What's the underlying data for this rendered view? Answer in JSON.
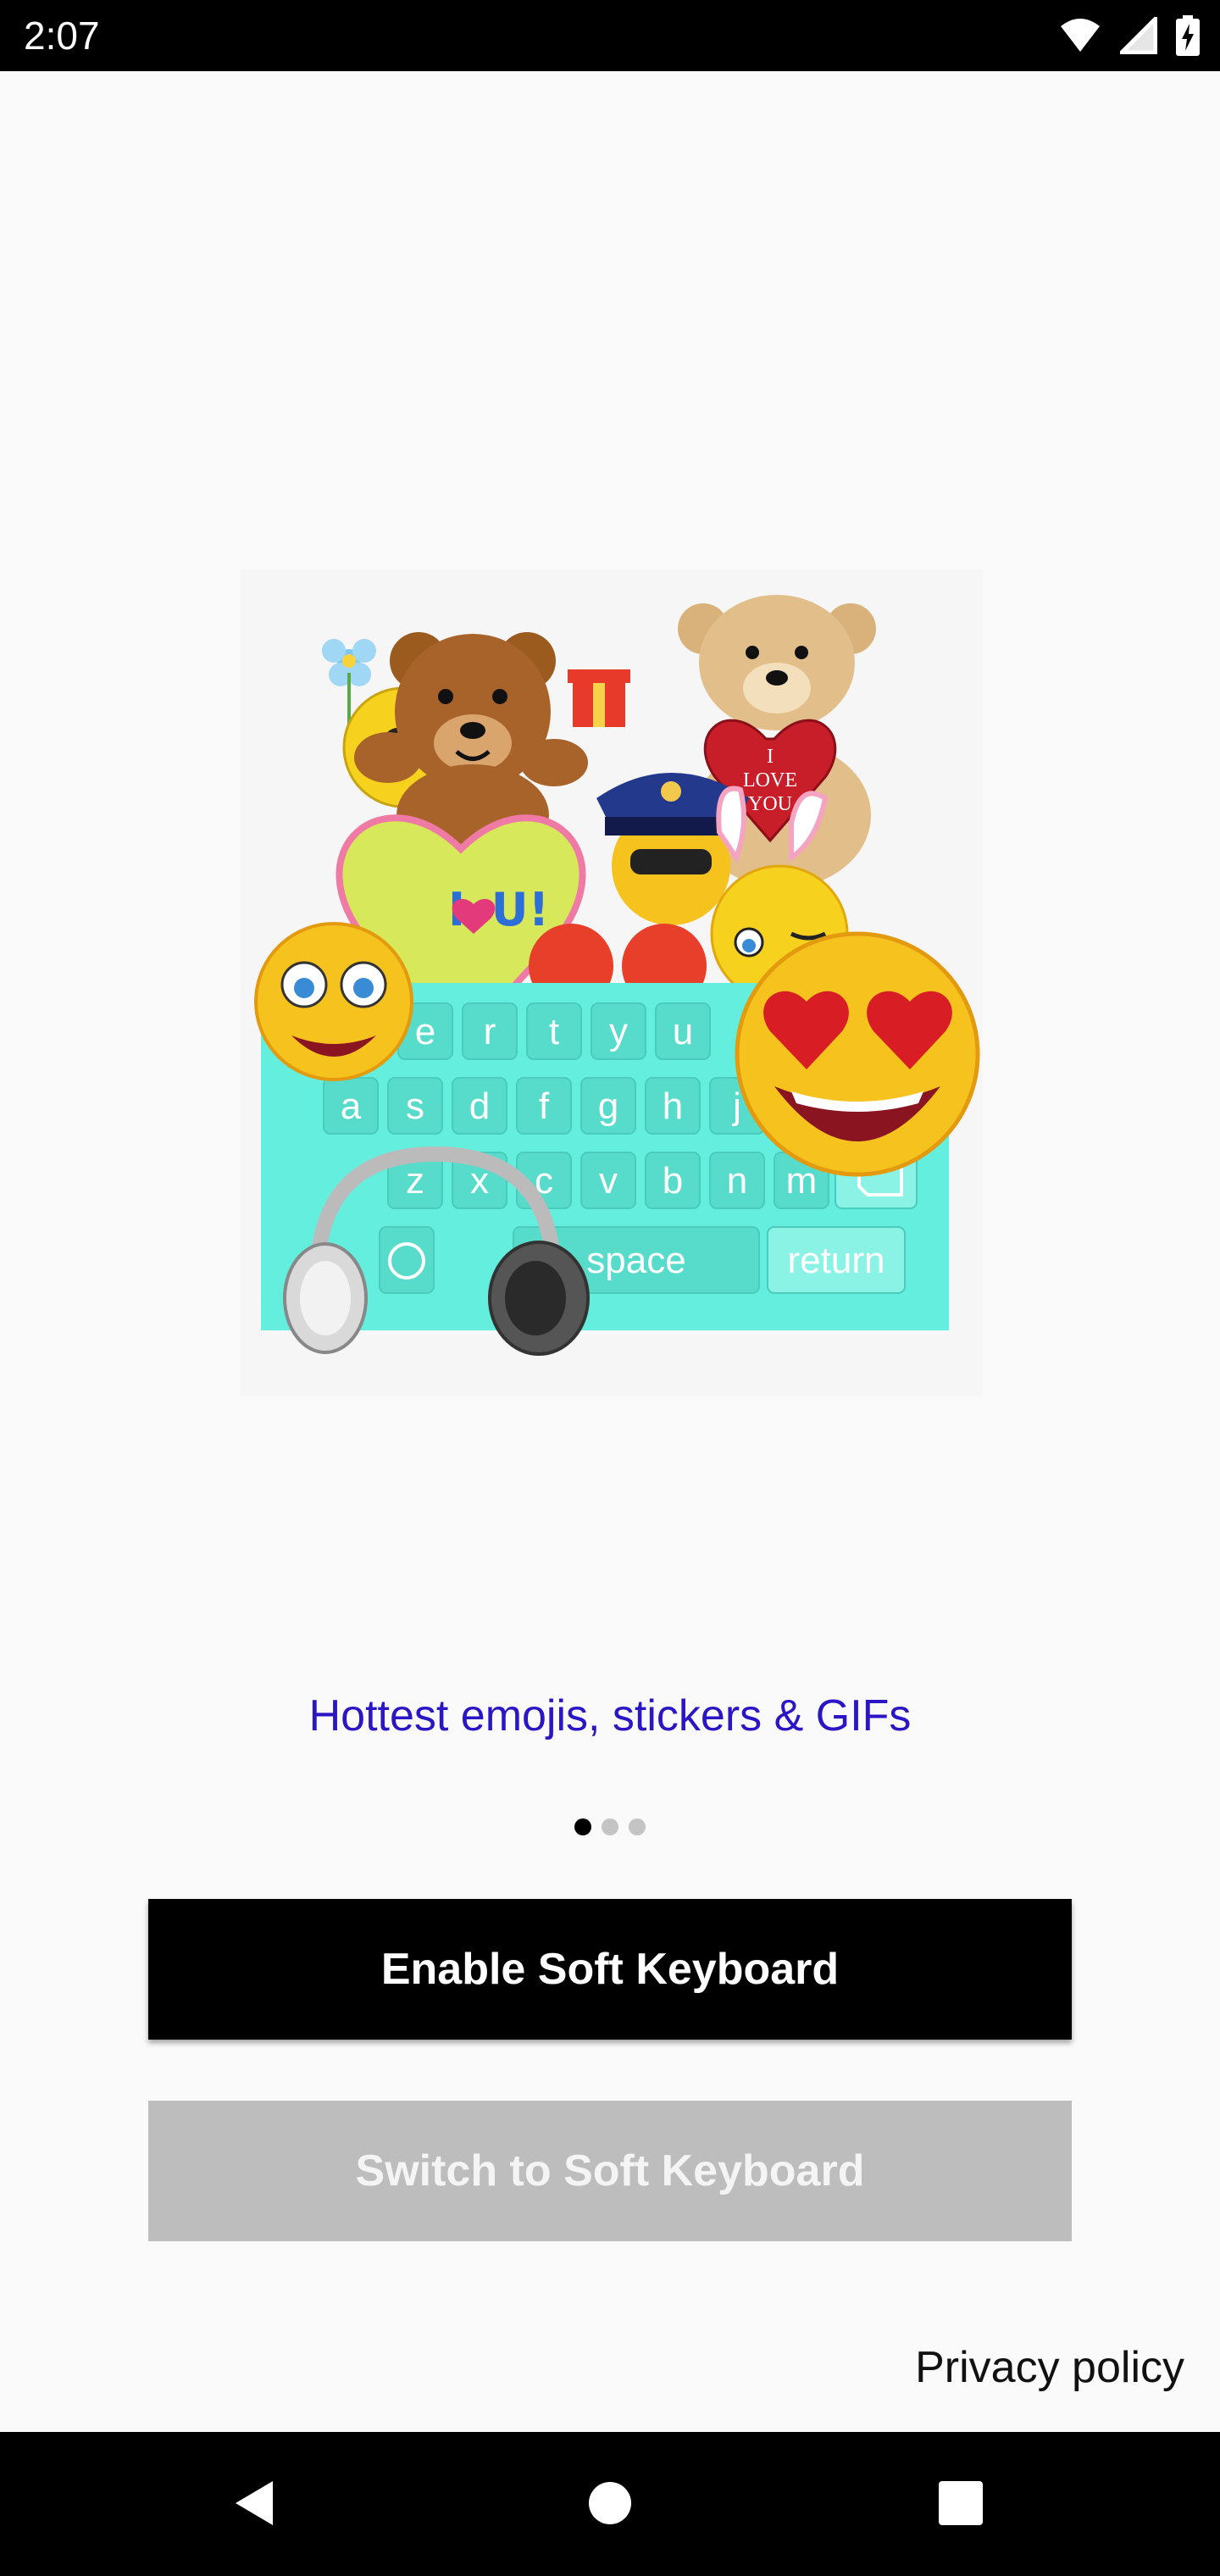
{
  "status_bar": {
    "time": "2:07",
    "icons": [
      "wifi-icon",
      "cell-signal-icon",
      "battery-charging-icon"
    ]
  },
  "hero": {
    "image": "emoji-keyboard-illustration",
    "keyboard_rows": [
      [
        "e",
        "r",
        "t",
        "y",
        "u"
      ],
      [
        "a",
        "s",
        "d",
        "f",
        "g",
        "h",
        "j"
      ],
      [
        "z",
        "x",
        "c",
        "v",
        "b",
        "n",
        "m"
      ]
    ],
    "space_label": "space",
    "return_label": "return",
    "sign_text": "I LOVE YOU",
    "heart_text": "I U!"
  },
  "tagline": "Hottest emojis, stickers & GIFs",
  "pager": {
    "count": 3,
    "active_index": 0
  },
  "buttons": {
    "enable_label": "Enable Soft Keyboard",
    "switch_label": "Switch to Soft Keyboard"
  },
  "privacy_label": "Privacy policy",
  "colors": {
    "tagline": "#2a16c4",
    "enable_bg": "#000000",
    "switch_bg": "#bdbdbd",
    "keyboard": "#63eedd"
  },
  "nav": {
    "icons": [
      "back-icon",
      "home-icon",
      "recents-icon"
    ]
  }
}
